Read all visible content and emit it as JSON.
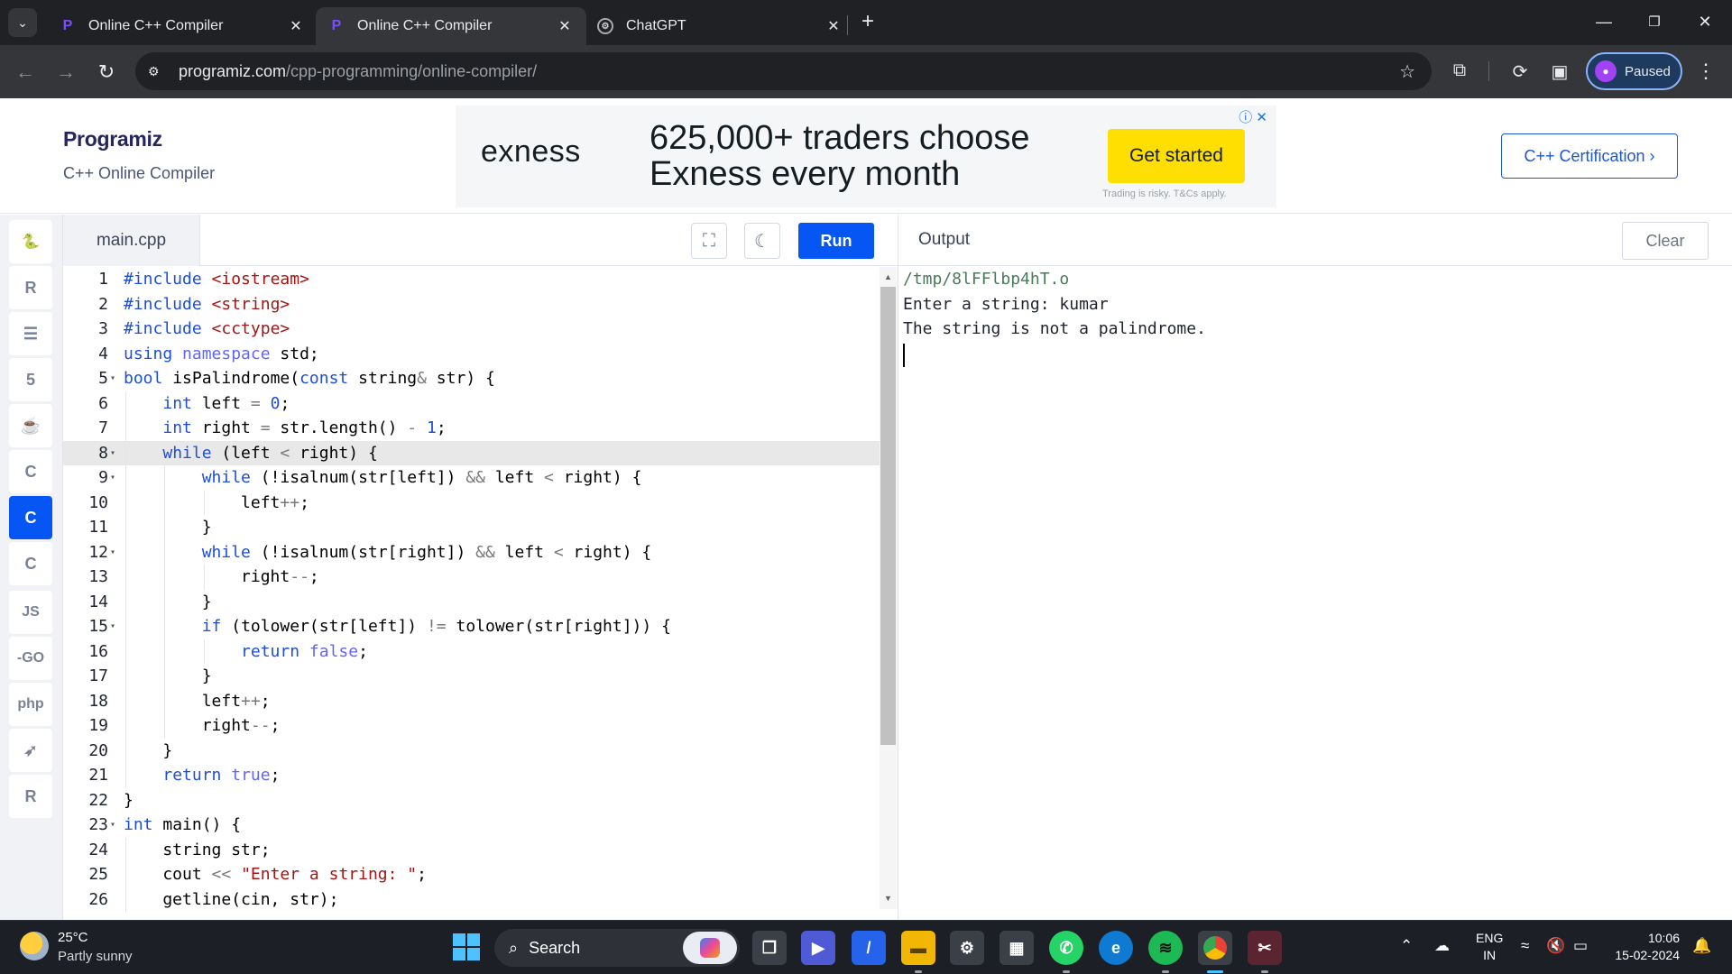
{
  "browser": {
    "tabs": [
      {
        "title": "Online C++ Compiler",
        "active": false,
        "favicon": "programiz-icon"
      },
      {
        "title": "Online C++ Compiler",
        "active": true,
        "favicon": "programiz-icon"
      },
      {
        "title": "ChatGPT",
        "active": false,
        "favicon": "chatgpt-icon"
      }
    ],
    "url_host": "programiz.com",
    "url_path": "/cpp-programming/online-compiler/",
    "profile_label": "Paused"
  },
  "header": {
    "logo": "Programiz",
    "subtitle": "C++ Online Compiler",
    "certification_label": "C++ Certification ›"
  },
  "ad": {
    "brand": "exness",
    "headline_1": "625,000+ traders choose",
    "headline_2": "Exness every month",
    "cta": "Get started",
    "disclaimer": "Trading is risky. T&Cs apply."
  },
  "sidebar": {
    "languages": [
      {
        "name": "python-icon",
        "glyph": "🐍",
        "active": false
      },
      {
        "name": "r-icon",
        "glyph": "R",
        "active": false
      },
      {
        "name": "database-icon",
        "glyph": "☰",
        "active": false
      },
      {
        "name": "html-icon",
        "glyph": "5",
        "active": false
      },
      {
        "name": "java-icon",
        "glyph": "☕",
        "active": false
      },
      {
        "name": "c-icon",
        "glyph": "C",
        "active": false
      },
      {
        "name": "cpp-icon",
        "glyph": "C",
        "active": true
      },
      {
        "name": "csharp-icon",
        "glyph": "C",
        "active": false
      },
      {
        "name": "js-icon",
        "glyph": "JS",
        "active": false
      },
      {
        "name": "go-icon",
        "glyph": "-GO",
        "active": false
      },
      {
        "name": "php-icon",
        "glyph": "php",
        "active": false
      },
      {
        "name": "swift-icon",
        "glyph": "➶",
        "active": false
      },
      {
        "name": "rust-icon",
        "glyph": "R",
        "active": false
      }
    ]
  },
  "editor": {
    "filename": "main.cpp",
    "run_label": "Run",
    "highlighted_line": 8,
    "lines": [
      "#include <iostream>",
      "#include <string>",
      "#include <cctype>",
      "using namespace std;",
      "bool isPalindrome(const string& str) {",
      "    int left = 0;",
      "    int right = str.length() - 1;",
      "    while (left < right) {",
      "        while (!isalnum(str[left]) && left < right) {",
      "            left++;",
      "        }",
      "        while (!isalnum(str[right]) && left < right) {",
      "            right--;",
      "        }",
      "        if (tolower(str[left]) != tolower(str[right])) {",
      "            return false;",
      "        }",
      "        left++;",
      "        right--;",
      "    }",
      "    return true;",
      "}",
      "int main() {",
      "    string str;",
      "    cout << \"Enter a string: \";",
      "    getline(cin, str);"
    ],
    "fold_lines": [
      5,
      8,
      9,
      12,
      15,
      23
    ]
  },
  "output": {
    "title": "Output",
    "clear_label": "Clear",
    "lines": [
      "/tmp/8lFFlbp4hT.o",
      "Enter a string: kumar",
      "The string is not a palindrome."
    ]
  },
  "taskbar": {
    "weather_temp": "25°C",
    "weather_desc": "Partly sunny",
    "search_label": "Search",
    "lang_line1": "ENG",
    "lang_line2": "IN",
    "time": "10:06",
    "date": "15-02-2024"
  }
}
